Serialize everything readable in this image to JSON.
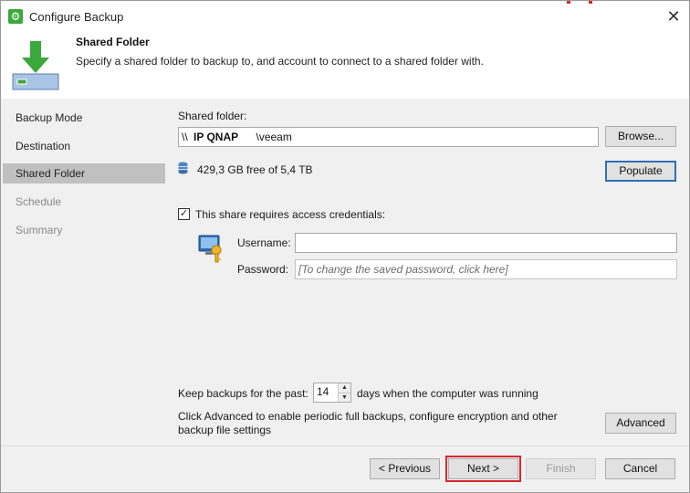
{
  "window": {
    "title": "Configure Backup",
    "close_glyph": "✕",
    "icon": "gear-icon"
  },
  "header": {
    "title": "Shared Folder",
    "description": "Specify a shared folder to backup to, and account to connect to a shared folder with.",
    "icon": "download-arrow-icon"
  },
  "sidebar": {
    "items": [
      {
        "label": "Backup Mode",
        "state": "normal"
      },
      {
        "label": "Destination",
        "state": "normal"
      },
      {
        "label": "Shared Folder",
        "state": "active"
      },
      {
        "label": "Schedule",
        "state": "disabled"
      },
      {
        "label": "Summary",
        "state": "disabled"
      }
    ]
  },
  "shared_folder": {
    "label": "Shared folder:",
    "value_prefix": "\\\\",
    "value_host": "IP QNAP",
    "value_suffix": "\\veeam",
    "browse_label": "Browse...",
    "free_space": "429,3 GB free of 5,4 TB",
    "populate_label": "Populate"
  },
  "credentials": {
    "checkbox_label": "This share requires access credentials:",
    "checked": true,
    "check_glyph": "✓",
    "username_label": "Username:",
    "username_value": "",
    "password_label": "Password:",
    "password_placeholder": "[To change the saved password, click here]"
  },
  "retention": {
    "label_before": "Keep backups for the past:",
    "days_value": "14",
    "label_after": "days when the computer was running",
    "up_glyph": "▲",
    "down_glyph": "▼"
  },
  "advanced": {
    "description_line1": "Click Advanced to enable periodic full backups, configure encryption and other",
    "description_line2": "backup file settings",
    "button_label": "Advanced"
  },
  "footer": {
    "previous_label": "< Previous",
    "next_label": "Next >",
    "finish_label": "Finish",
    "cancel_label": "Cancel"
  },
  "colors": {
    "accent_green": "#3aa83a",
    "focus_blue": "#2f6fb5",
    "highlight_red": "#d9262c",
    "panel_gray": "#f0f0f0"
  }
}
